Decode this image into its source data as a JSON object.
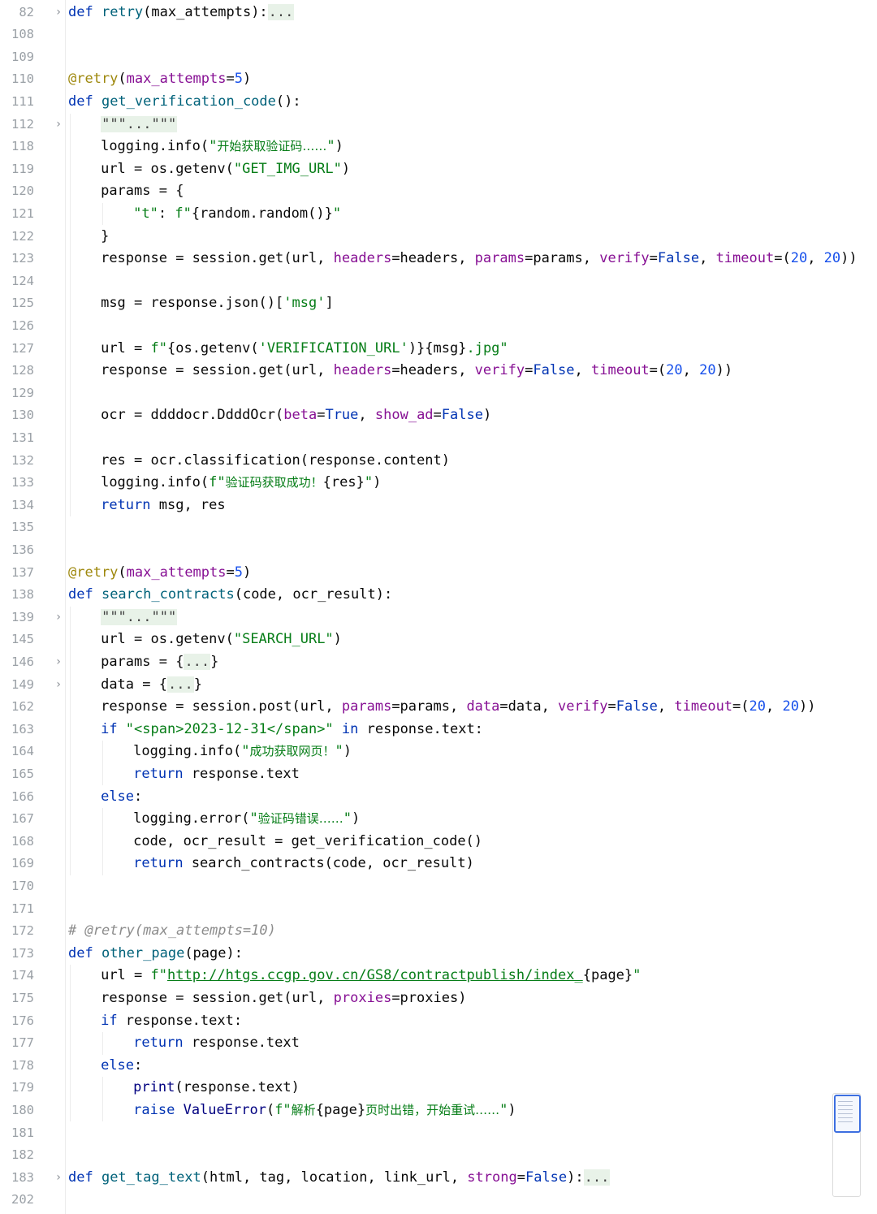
{
  "editor": {
    "language": "python",
    "lines": [
      {
        "n": "82",
        "fold": "›",
        "indent": 0,
        "tokens": [
          [
            "kw",
            "def "
          ],
          [
            "fn",
            "retry"
          ],
          [
            "",
            "(max_attempts):"
          ],
          [
            "fd",
            "..."
          ]
        ]
      },
      {
        "n": "108",
        "fold": "",
        "indent": 0,
        "tokens": []
      },
      {
        "n": "109",
        "fold": "",
        "indent": 0,
        "tokens": []
      },
      {
        "n": "110",
        "fold": "",
        "indent": 0,
        "tokens": [
          [
            "dec",
            "@retry"
          ],
          [
            "",
            "("
          ],
          [
            "prm",
            "max_attempts"
          ],
          [
            "",
            "="
          ],
          [
            "num",
            "5"
          ],
          [
            "",
            ")"
          ]
        ]
      },
      {
        "n": "111",
        "fold": "",
        "indent": 0,
        "tokens": [
          [
            "kw",
            "def "
          ],
          [
            "fn",
            "get_verification_code"
          ],
          [
            "",
            "():"
          ]
        ]
      },
      {
        "n": "112",
        "fold": "›",
        "indent": 1,
        "tokens": [
          [
            "fd",
            "\"\"\"...\"\"\""
          ]
        ]
      },
      {
        "n": "118",
        "fold": "",
        "indent": 1,
        "tokens": [
          [
            "",
            "logging.info("
          ],
          [
            "str",
            "\""
          ],
          [
            "str cn",
            "开始获取验证码……"
          ],
          [
            "str",
            "\""
          ],
          [
            "",
            ")"
          ]
        ]
      },
      {
        "n": "119",
        "fold": "",
        "indent": 1,
        "tokens": [
          [
            "",
            "url = os.getenv("
          ],
          [
            "str",
            "\"GET_IMG_URL\""
          ],
          [
            "",
            ")"
          ]
        ]
      },
      {
        "n": "120",
        "fold": "",
        "indent": 1,
        "tokens": [
          [
            "",
            "params = {"
          ]
        ]
      },
      {
        "n": "121",
        "fold": "",
        "indent": 2,
        "tokens": [
          [
            "str",
            "\"t\""
          ],
          [
            "",
            ": "
          ],
          [
            "str",
            "f\""
          ],
          [
            "",
            "{random.random()}"
          ],
          [
            "str",
            "\""
          ]
        ]
      },
      {
        "n": "122",
        "fold": "",
        "indent": 1,
        "tokens": [
          [
            "",
            "}"
          ]
        ]
      },
      {
        "n": "123",
        "fold": "",
        "indent": 1,
        "tokens": [
          [
            "",
            "response = session.get(url, "
          ],
          [
            "prm",
            "headers"
          ],
          [
            "",
            "=headers, "
          ],
          [
            "prm",
            "params"
          ],
          [
            "",
            "=params, "
          ],
          [
            "prm",
            "verify"
          ],
          [
            "",
            "="
          ],
          [
            "kw",
            "False"
          ],
          [
            "",
            ", "
          ],
          [
            "prm",
            "timeout"
          ],
          [
            "",
            "=("
          ],
          [
            "num",
            "20"
          ],
          [
            "",
            ", "
          ],
          [
            "num",
            "20"
          ],
          [
            "",
            "))"
          ]
        ]
      },
      {
        "n": "124",
        "fold": "",
        "indent": 0,
        "tokens": []
      },
      {
        "n": "125",
        "fold": "",
        "indent": 1,
        "tokens": [
          [
            "",
            "msg = response.json()["
          ],
          [
            "str",
            "'msg'"
          ],
          [
            "",
            "]"
          ]
        ]
      },
      {
        "n": "126",
        "fold": "",
        "indent": 0,
        "tokens": []
      },
      {
        "n": "127",
        "fold": "",
        "indent": 1,
        "tokens": [
          [
            "",
            "url = "
          ],
          [
            "str",
            "f\""
          ],
          [
            "",
            "{os.getenv("
          ],
          [
            "str",
            "'VERIFICATION_URL'"
          ],
          [
            "",
            ")}{msg}"
          ],
          [
            "str",
            ".jpg\""
          ]
        ]
      },
      {
        "n": "128",
        "fold": "",
        "indent": 1,
        "tokens": [
          [
            "",
            "response = session.get(url, "
          ],
          [
            "prm",
            "headers"
          ],
          [
            "",
            "=headers, "
          ],
          [
            "prm",
            "verify"
          ],
          [
            "",
            "="
          ],
          [
            "kw",
            "False"
          ],
          [
            "",
            ", "
          ],
          [
            "prm",
            "timeout"
          ],
          [
            "",
            "=("
          ],
          [
            "num",
            "20"
          ],
          [
            "",
            ", "
          ],
          [
            "num",
            "20"
          ],
          [
            "",
            "))"
          ]
        ]
      },
      {
        "n": "129",
        "fold": "",
        "indent": 0,
        "tokens": []
      },
      {
        "n": "130",
        "fold": "",
        "indent": 1,
        "tokens": [
          [
            "",
            "ocr = ddddocr.DdddOcr("
          ],
          [
            "prm",
            "beta"
          ],
          [
            "",
            "="
          ],
          [
            "kw",
            "True"
          ],
          [
            "",
            ", "
          ],
          [
            "prm",
            "show_ad"
          ],
          [
            "",
            "="
          ],
          [
            "kw",
            "False"
          ],
          [
            "",
            ")"
          ]
        ]
      },
      {
        "n": "131",
        "fold": "",
        "indent": 0,
        "tokens": []
      },
      {
        "n": "132",
        "fold": "",
        "indent": 1,
        "tokens": [
          [
            "",
            "res = ocr.classification(response.content)"
          ]
        ]
      },
      {
        "n": "133",
        "fold": "",
        "indent": 1,
        "tokens": [
          [
            "",
            "logging.info("
          ],
          [
            "str",
            "f\""
          ],
          [
            "str cn",
            "验证码获取成功！"
          ],
          [
            "",
            "{res}"
          ],
          [
            "str",
            "\""
          ],
          [
            "",
            ")"
          ]
        ]
      },
      {
        "n": "134",
        "fold": "",
        "indent": 1,
        "tokens": [
          [
            "kw",
            "return "
          ],
          [
            "",
            "msg, res"
          ]
        ]
      },
      {
        "n": "135",
        "fold": "",
        "indent": 0,
        "tokens": []
      },
      {
        "n": "136",
        "fold": "",
        "indent": 0,
        "tokens": []
      },
      {
        "n": "137",
        "fold": "",
        "indent": 0,
        "tokens": [
          [
            "dec",
            "@retry"
          ],
          [
            "",
            "("
          ],
          [
            "prm",
            "max_attempts"
          ],
          [
            "",
            "="
          ],
          [
            "num",
            "5"
          ],
          [
            "",
            ")"
          ]
        ]
      },
      {
        "n": "138",
        "fold": "",
        "indent": 0,
        "tokens": [
          [
            "kw",
            "def "
          ],
          [
            "fn",
            "search_contracts"
          ],
          [
            "",
            "(code, ocr_result):"
          ]
        ]
      },
      {
        "n": "139",
        "fold": "›",
        "indent": 1,
        "tokens": [
          [
            "fd",
            "\"\"\"...\"\"\""
          ]
        ]
      },
      {
        "n": "145",
        "fold": "",
        "indent": 1,
        "tokens": [
          [
            "",
            "url = os.getenv("
          ],
          [
            "str",
            "\"SEARCH_URL\""
          ],
          [
            "",
            ")"
          ]
        ]
      },
      {
        "n": "146",
        "fold": "›",
        "indent": 1,
        "tokens": [
          [
            "",
            "params = {"
          ],
          [
            "fd",
            "..."
          ],
          [
            "",
            "}"
          ]
        ]
      },
      {
        "n": "149",
        "fold": "›",
        "indent": 1,
        "tokens": [
          [
            "",
            "data = {"
          ],
          [
            "fd",
            "..."
          ],
          [
            "",
            "}"
          ]
        ]
      },
      {
        "n": "162",
        "fold": "",
        "indent": 1,
        "tokens": [
          [
            "",
            "response = session.post(url, "
          ],
          [
            "prm",
            "params"
          ],
          [
            "",
            "=params, "
          ],
          [
            "prm",
            "data"
          ],
          [
            "",
            "=data, "
          ],
          [
            "prm",
            "verify"
          ],
          [
            "",
            "="
          ],
          [
            "kw",
            "False"
          ],
          [
            "",
            ", "
          ],
          [
            "prm",
            "timeout"
          ],
          [
            "",
            "=("
          ],
          [
            "num",
            "20"
          ],
          [
            "",
            ", "
          ],
          [
            "num",
            "20"
          ],
          [
            "",
            "))"
          ]
        ]
      },
      {
        "n": "163",
        "fold": "",
        "indent": 1,
        "tokens": [
          [
            "kw",
            "if "
          ],
          [
            "str",
            "\"<span>2023-12-31</span>\""
          ],
          [
            "kw",
            " in "
          ],
          [
            "",
            "response.text:"
          ]
        ]
      },
      {
        "n": "164",
        "fold": "",
        "indent": 2,
        "tokens": [
          [
            "",
            "logging.info("
          ],
          [
            "str",
            "\""
          ],
          [
            "str cn",
            "成功获取网页！"
          ],
          [
            "str",
            "\""
          ],
          [
            "",
            ")"
          ]
        ]
      },
      {
        "n": "165",
        "fold": "",
        "indent": 2,
        "tokens": [
          [
            "kw",
            "return "
          ],
          [
            "",
            "response.text"
          ]
        ]
      },
      {
        "n": "166",
        "fold": "",
        "indent": 1,
        "tokens": [
          [
            "kw",
            "else"
          ],
          [
            "",
            ":"
          ]
        ]
      },
      {
        "n": "167",
        "fold": "",
        "indent": 2,
        "tokens": [
          [
            "",
            "logging.error("
          ],
          [
            "str",
            "\""
          ],
          [
            "str cn",
            "验证码错误……"
          ],
          [
            "str",
            "\""
          ],
          [
            "",
            ")"
          ]
        ]
      },
      {
        "n": "168",
        "fold": "",
        "indent": 2,
        "tokens": [
          [
            "",
            "code, ocr_result = get_verification_code()"
          ]
        ]
      },
      {
        "n": "169",
        "fold": "",
        "indent": 2,
        "tokens": [
          [
            "kw",
            "return "
          ],
          [
            "",
            "search_contracts(code, ocr_result)"
          ]
        ]
      },
      {
        "n": "170",
        "fold": "",
        "indent": 0,
        "tokens": []
      },
      {
        "n": "171",
        "fold": "",
        "indent": 0,
        "tokens": []
      },
      {
        "n": "172",
        "fold": "",
        "indent": 0,
        "tokens": [
          [
            "cmt",
            "# @retry(max_attempts=10)"
          ]
        ]
      },
      {
        "n": "173",
        "fold": "",
        "indent": 0,
        "tokens": [
          [
            "kw",
            "def "
          ],
          [
            "fn",
            "other_page"
          ],
          [
            "",
            "(page):"
          ]
        ]
      },
      {
        "n": "174",
        "fold": "",
        "indent": 1,
        "tokens": [
          [
            "",
            "url = "
          ],
          [
            "str",
            "f\""
          ],
          [
            "url",
            "http://htgs.ccgp.gov.cn/GS8/contractpublish/index_"
          ],
          [
            "",
            "{page}"
          ],
          [
            "str",
            "\""
          ]
        ]
      },
      {
        "n": "175",
        "fold": "",
        "indent": 1,
        "tokens": [
          [
            "",
            "response = session.get(url, "
          ],
          [
            "prm",
            "proxies"
          ],
          [
            "",
            "=proxies)"
          ]
        ]
      },
      {
        "n": "176",
        "fold": "",
        "indent": 1,
        "tokens": [
          [
            "kw",
            "if "
          ],
          [
            "",
            "response.text:"
          ]
        ]
      },
      {
        "n": "177",
        "fold": "",
        "indent": 2,
        "tokens": [
          [
            "kw",
            "return "
          ],
          [
            "",
            "response.text"
          ]
        ]
      },
      {
        "n": "178",
        "fold": "",
        "indent": 1,
        "tokens": [
          [
            "kw",
            "else"
          ],
          [
            "",
            ":"
          ]
        ]
      },
      {
        "n": "179",
        "fold": "",
        "indent": 2,
        "tokens": [
          [
            "bi",
            "print"
          ],
          [
            "",
            "(response.text)"
          ]
        ]
      },
      {
        "n": "180",
        "fold": "",
        "indent": 2,
        "tokens": [
          [
            "kw",
            "raise "
          ],
          [
            "bi",
            "ValueError"
          ],
          [
            "",
            "("
          ],
          [
            "str",
            "f\""
          ],
          [
            "str cn",
            "解析"
          ],
          [
            "",
            "{page}"
          ],
          [
            "str cn",
            "页时出错，开始重试……"
          ],
          [
            "str",
            "\""
          ],
          [
            "",
            ")"
          ]
        ]
      },
      {
        "n": "181",
        "fold": "",
        "indent": 0,
        "tokens": []
      },
      {
        "n": "182",
        "fold": "",
        "indent": 0,
        "tokens": []
      },
      {
        "n": "183",
        "fold": "›",
        "indent": 0,
        "tokens": [
          [
            "kw",
            "def "
          ],
          [
            "fn",
            "get_tag_text"
          ],
          [
            "",
            "(html, tag, location, link_url, "
          ],
          [
            "prm",
            "strong"
          ],
          [
            "",
            "="
          ],
          [
            "kw",
            "False"
          ],
          [
            "",
            "):"
          ],
          [
            "fd",
            "..."
          ]
        ]
      },
      {
        "n": "202",
        "fold": "",
        "indent": 0,
        "tokens": []
      }
    ],
    "colors": {
      "keyword": "#0033b3",
      "function": "#00627a",
      "decorator": "#9e880d",
      "parameter": "#871094",
      "string": "#067d17",
      "number": "#1750eb",
      "comment": "#8c8c8c",
      "line_number": "#9aa0a6"
    }
  }
}
